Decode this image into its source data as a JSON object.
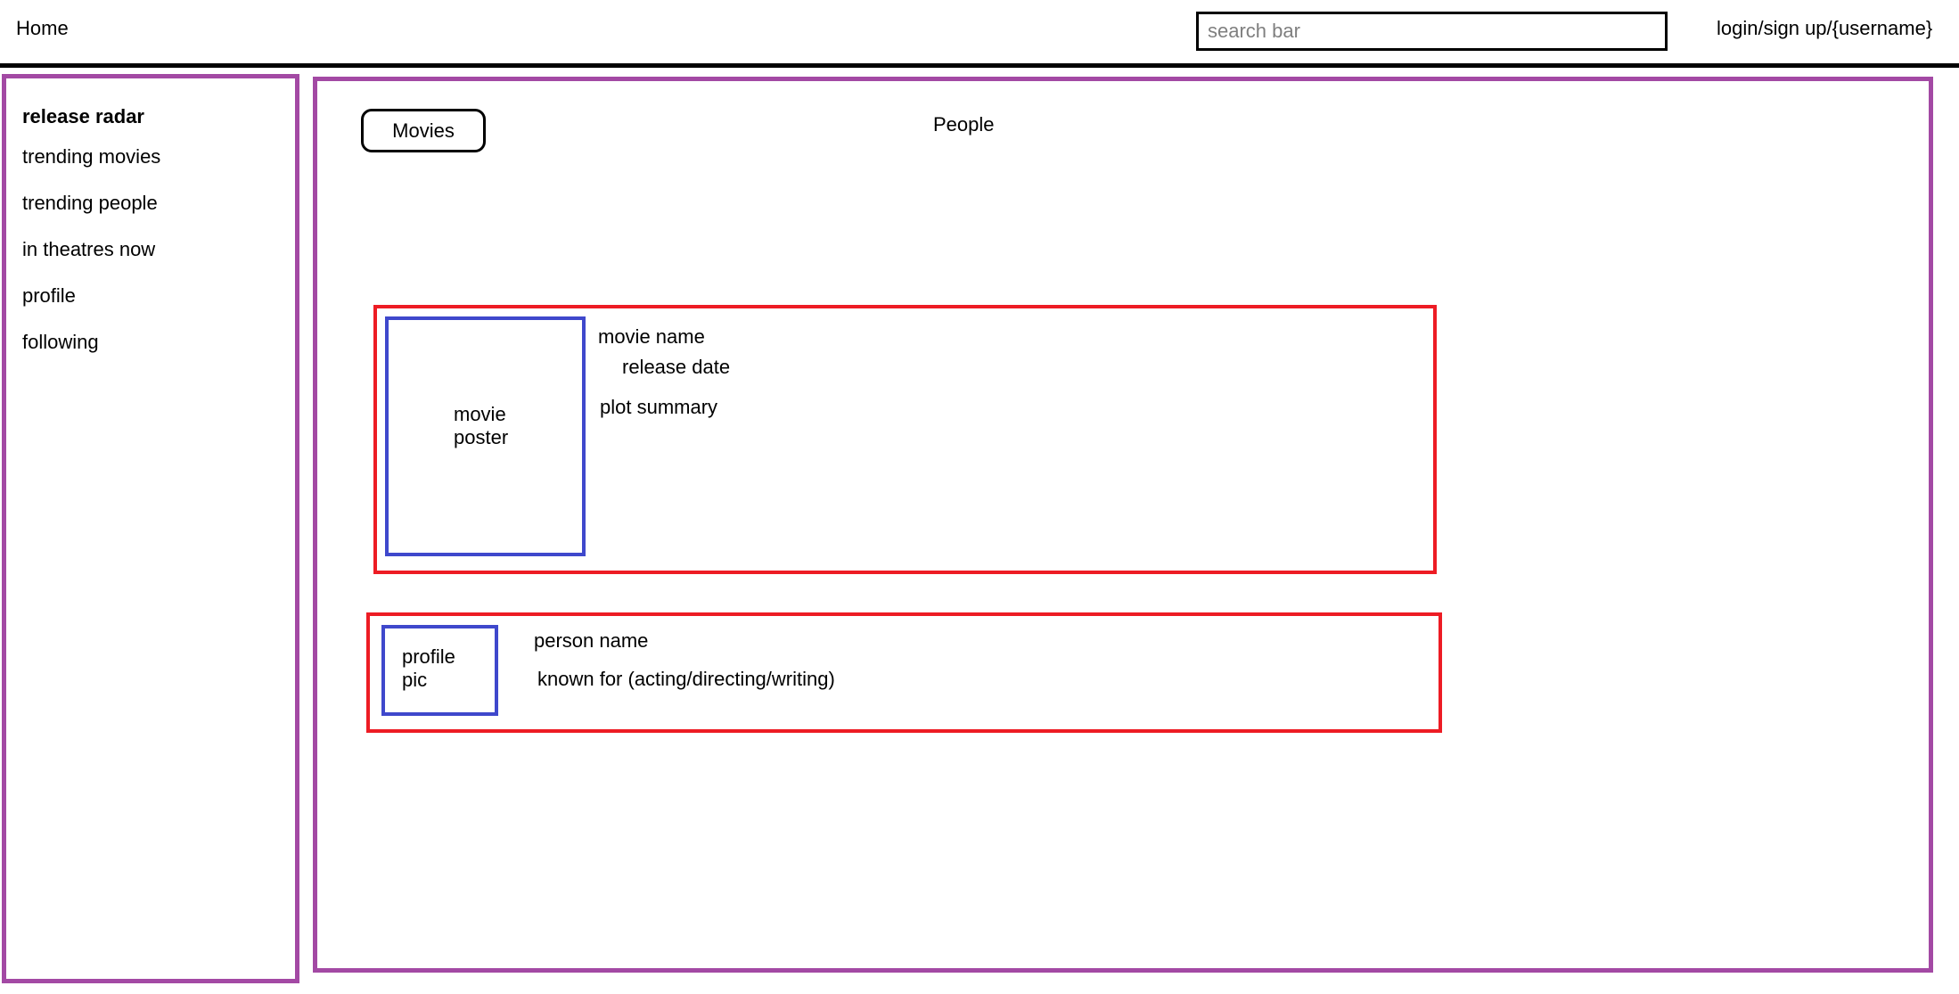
{
  "header": {
    "home_label": "Home",
    "search_placeholder": "search bar",
    "account_label": "login/sign up/{username}"
  },
  "sidebar": {
    "items": [
      {
        "label": "release radar"
      },
      {
        "label": "trending movies"
      },
      {
        "label": "trending people"
      },
      {
        "label": "in theatres now"
      },
      {
        "label": "profile"
      },
      {
        "label": "following"
      }
    ]
  },
  "main": {
    "tabs": [
      {
        "label": "Movies"
      },
      {
        "label": "People"
      }
    ],
    "movie_card": {
      "poster_line1": "movie",
      "poster_line2": "poster",
      "name": "movie name",
      "release_date": "release date",
      "plot": "plot summary"
    },
    "person_card": {
      "pic_line1": "profile",
      "pic_line2": "pic",
      "name": "person name",
      "known_for": "known for (acting/directing/writing)"
    }
  },
  "colors": {
    "panel_border": "#a349a4",
    "card_border": "#ed1c24",
    "image_border": "#3f48cc"
  }
}
